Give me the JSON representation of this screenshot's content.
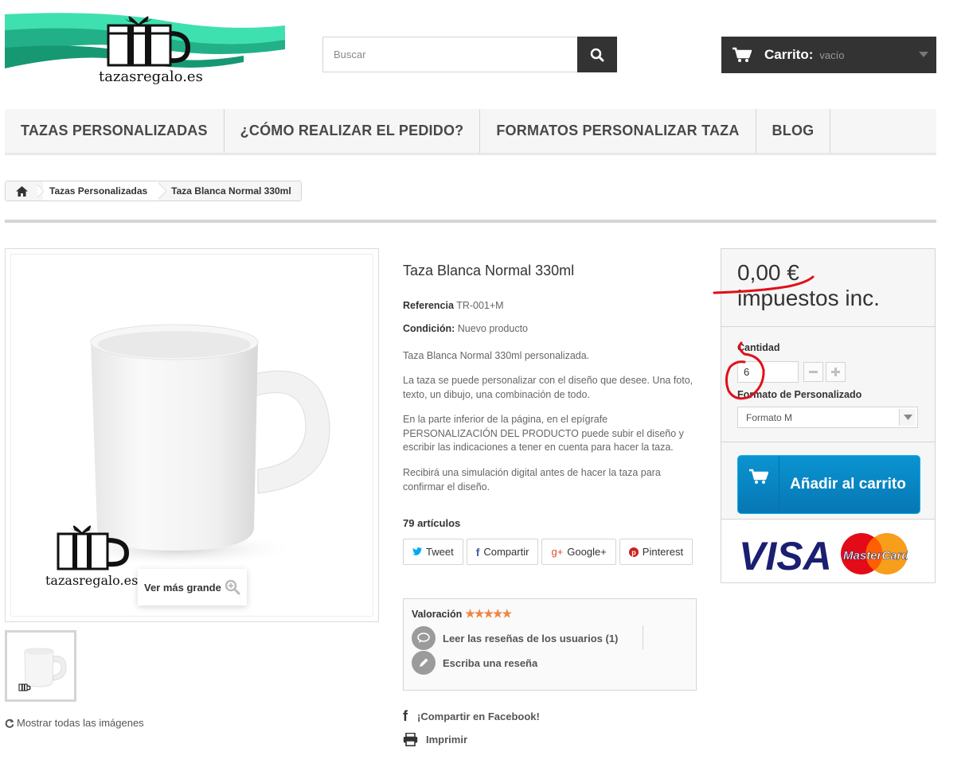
{
  "header": {
    "logo_text": "tazasregalo.es",
    "search": {
      "placeholder": "Buscar",
      "value": ""
    },
    "cart": {
      "title": "Carrito:",
      "status": "vacío"
    }
  },
  "nav": {
    "items": [
      {
        "label": "TAZAS PERSONALIZADAS"
      },
      {
        "label": "¿CÓMO REALIZAR EL PEDIDO?"
      },
      {
        "label": "FORMATOS PERSONALIZAR TAZA"
      },
      {
        "label": "BLOG"
      }
    ]
  },
  "breadcrumb": {
    "category": "Tazas Personalizadas",
    "current": "Taza Blanca Normal 330ml"
  },
  "gallery": {
    "watermark": "tazasregalo.es",
    "view_larger": "Ver más grande",
    "show_all": "Mostrar todas las imágenes"
  },
  "product": {
    "title": "Taza Blanca Normal 330ml",
    "reference_label": "Referencia",
    "reference": "TR-001+M",
    "condition_label": "Condición:",
    "condition": "Nuevo producto",
    "description": [
      "Taza Blanca Normal 330ml personalizada.",
      "La taza se puede personalizar con el diseño que desee. Una foto, texto, un dibujo, una combinación de todo.",
      "En la parte inferior de la página, en el epígrafe PERSONALIZACIÓN DEL PRODUCTO puede subir el diseño y escribir las indicaciones a tener en cuenta para hacer la taza.",
      "Recibirá una simulación digital antes de hacer la taza para confirmar el diseño."
    ],
    "quantity_available": "79 artículos"
  },
  "social": {
    "tweet": "Tweet",
    "share": "Compartir",
    "google": "Google+",
    "pinterest": "Pinterest"
  },
  "reviews": {
    "title": "Valoración",
    "stars": 5,
    "read_link": "Leer las reseñas de los usuarios (1)",
    "write_link": "Escriba una reseña"
  },
  "extra": {
    "facebook": "¡Compartir en Facebook!",
    "print": "Imprimir"
  },
  "buybox": {
    "price": "0,00 €",
    "tax": "impuestos inc.",
    "quantity_label": "Cantidad",
    "quantity_value": "6",
    "format_label": "Formato de Personalizado",
    "format_value": "Formato M",
    "add_to_cart": "Añadir al carrito",
    "card_visa": "VISA",
    "card_mastercard": "MasterCard"
  },
  "colors": {
    "dark": "#333333",
    "accent_blue": "#0a94d1",
    "star": "#ef8743",
    "annotation_red": "#e0101a",
    "logo_teal": "#2fd6a8"
  }
}
